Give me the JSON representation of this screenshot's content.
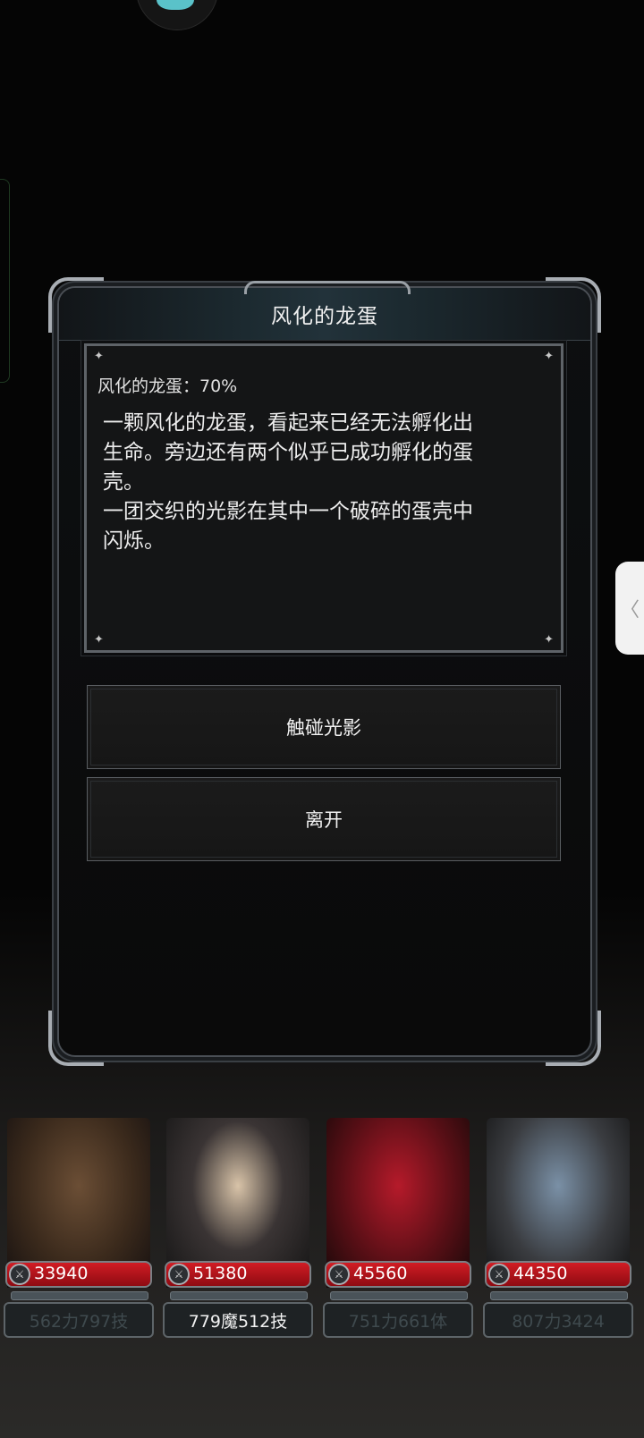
{
  "dialog": {
    "title": "风化的龙蛋",
    "header": "风化的龙蛋：70%",
    "description": "一颗风化的龙蛋，看起来已经无法孵化出\n生命。旁边还有两个似乎已成功孵化的蛋\n壳。\n一团交织的光影在其中一个破碎的蛋壳中\n闪烁。",
    "choices": [
      "触碰光影",
      "离开"
    ]
  },
  "side_handle_glyph": "〈",
  "party": [
    {
      "hp": "33940",
      "stats": "562力797技",
      "active": false
    },
    {
      "hp": "51380",
      "stats": "779魔512技",
      "active": true
    },
    {
      "hp": "45560",
      "stats": "751力661体",
      "active": false
    },
    {
      "hp": "44350",
      "stats": "807力3424",
      "active": false
    }
  ],
  "colors": {
    "hp_bar": "#c1141c",
    "title_bar": "#22323a",
    "background": "#050505"
  }
}
